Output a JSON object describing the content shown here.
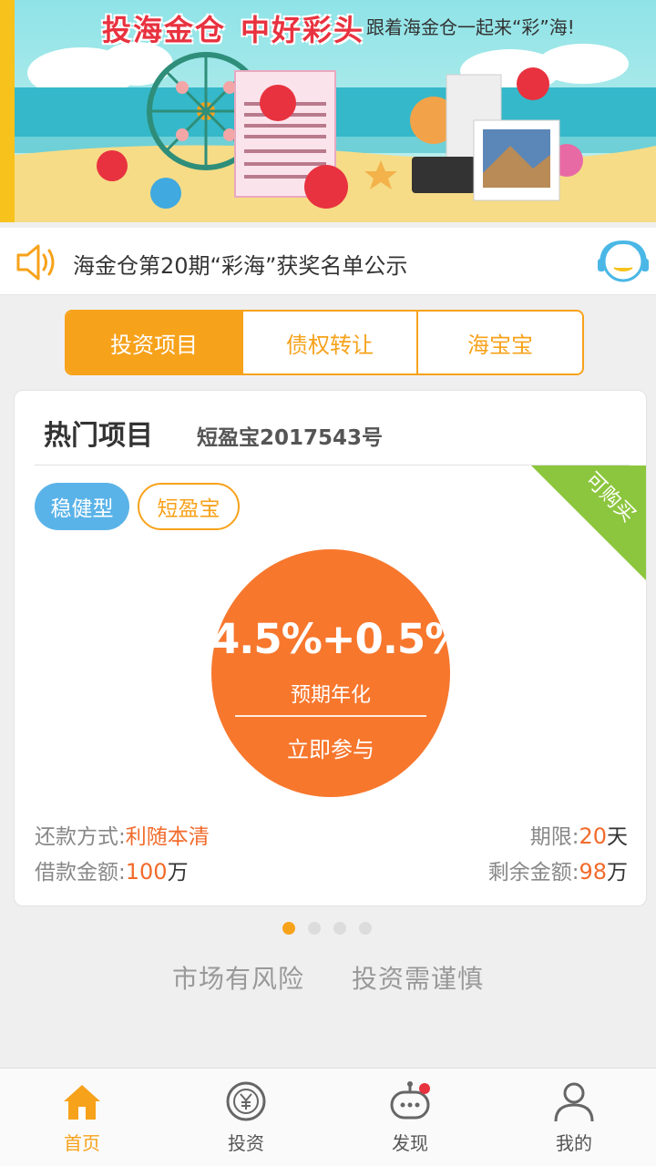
{
  "banner": {
    "headline_part1": "投海金仓",
    "headline_part2": "中好彩头",
    "subline": "跟着海金仓一起来“彩”海!"
  },
  "notice": {
    "text": "海金仓第20期“彩海”获奖名单公示"
  },
  "tabs": [
    {
      "label": "投资项目",
      "active": true
    },
    {
      "label": "债权转让",
      "active": false
    },
    {
      "label": "海宝宝",
      "active": false
    }
  ],
  "card": {
    "title": "热门项目",
    "product_name": "短盈宝2017543号",
    "tags": [
      "稳健型",
      "短盈宝"
    ],
    "ribbon": "可购买",
    "rate": "4.5%+0.5%",
    "rate_label": "预期年化",
    "join_label": "立即参与",
    "repay_label": "还款方式:",
    "repay_value": "利随本清",
    "term_label": "期限:",
    "term_value": "20",
    "term_unit": "天",
    "amount_label": "借款金额:",
    "amount_value": "100",
    "amount_unit": "万",
    "remain_label": "剩余金额:",
    "remain_value": "98",
    "remain_unit": "万"
  },
  "carousel": {
    "total": 4,
    "active": 1
  },
  "risk": {
    "left": "市场有风险",
    "right": "投资需谨慎"
  },
  "nav": [
    {
      "label": "首页",
      "icon": "home-icon",
      "active": true
    },
    {
      "label": "投资",
      "icon": "yuan-coin-icon",
      "active": false
    },
    {
      "label": "发现",
      "icon": "discover-robot-icon",
      "active": false
    },
    {
      "label": "我的",
      "icon": "user-icon",
      "active": false
    }
  ],
  "colors": {
    "accent": "#f7a21b",
    "rate_circle": "#f7772d",
    "tag_blue": "#5ab3e8",
    "ribbon_green": "#8cc63e",
    "highlight": "#f26b2b"
  }
}
